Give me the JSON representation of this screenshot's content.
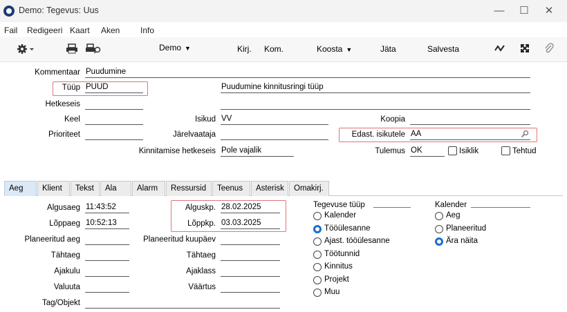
{
  "window": {
    "title": "Demo: Tegevus: Uus",
    "minimize": "—",
    "maximize": "☐",
    "close": "✕"
  },
  "menu": [
    "Fail",
    "Redigeeri",
    "Kaart",
    "Aken",
    "Info"
  ],
  "toolbar": {
    "demo": "Demo",
    "kirj": "Kirj.",
    "kom": "Kom.",
    "koosta": "Koosta",
    "jata": "Jäta",
    "salvesta": "Salvesta"
  },
  "header": {
    "kommentaar": {
      "label": "Kommentaar",
      "value": "Puudumine"
    },
    "tyyp": {
      "label": "Tüüp",
      "value": "PUUD",
      "description": "Puudumine kinnitusringi tüüp"
    },
    "hetkeseis": {
      "label": "Hetkeseis",
      "value": ""
    },
    "keel": {
      "label": "Keel",
      "value": ""
    },
    "isikud": {
      "label": "Isikud",
      "value": "VV"
    },
    "koopia": {
      "label": "Koopia",
      "value": ""
    },
    "prioriteet": {
      "label": "Prioriteet",
      "value": ""
    },
    "jarelvaataja": {
      "label": "Järelvaataja",
      "value": ""
    },
    "edast": {
      "label": "Edast. isikutele",
      "value": "AA"
    },
    "kinnitamise": {
      "label": "Kinnitamise hetkeseis",
      "value": "Pole vajalik"
    },
    "tulemus": {
      "label": "Tulemus",
      "value": "OK"
    },
    "isiklik": "Isiklik",
    "tehtud": "Tehtud"
  },
  "tabs": [
    "Aeg",
    "Klient",
    "Tekst",
    "Ala",
    "Alarm",
    "Ressursid",
    "Teenus",
    "Asterisk",
    "Omakirj."
  ],
  "aeg": {
    "algusaeg": {
      "label": "Algusaeg",
      "value": "11:43:52"
    },
    "loppaeg": {
      "label": "Lõppaeg",
      "value": "10:52:13"
    },
    "planeeritud_aeg": {
      "label": "Planeeritud aeg",
      "value": ""
    },
    "tahtaeg": {
      "label": "Tähtaeg",
      "value": ""
    },
    "ajakulu": {
      "label": "Ajakulu",
      "value": ""
    },
    "valuuta": {
      "label": "Valuuta",
      "value": ""
    },
    "tag": {
      "label": "Tag/Objekt",
      "value": ""
    },
    "alguskp": {
      "label": "Alguskp.",
      "value": "28.02.2025"
    },
    "loppkp": {
      "label": "Lõppkp.",
      "value": "03.03.2025"
    },
    "planeeritud_kp": {
      "label": "Planeeritud kuupäev",
      "value": ""
    },
    "tahtaeg2": {
      "label": "Tähtaeg",
      "value": ""
    },
    "ajaklass": {
      "label": "Ajaklass",
      "value": ""
    },
    "vaartus": {
      "label": "Väärtus",
      "value": ""
    }
  },
  "tegevuse_tyyp": {
    "label": "Tegevuse tüüp",
    "options": [
      "Kalender",
      "Tööülesanne",
      "Ajast. tööülesanne",
      "Töötunnid",
      "Kinnitus",
      "Projekt",
      "Muu"
    ],
    "selected": "Tööülesanne"
  },
  "kalender": {
    "label": "Kalender",
    "options": [
      "Aeg",
      "Planeeritud",
      "Ära näita"
    ],
    "selected": "Ära näita"
  }
}
